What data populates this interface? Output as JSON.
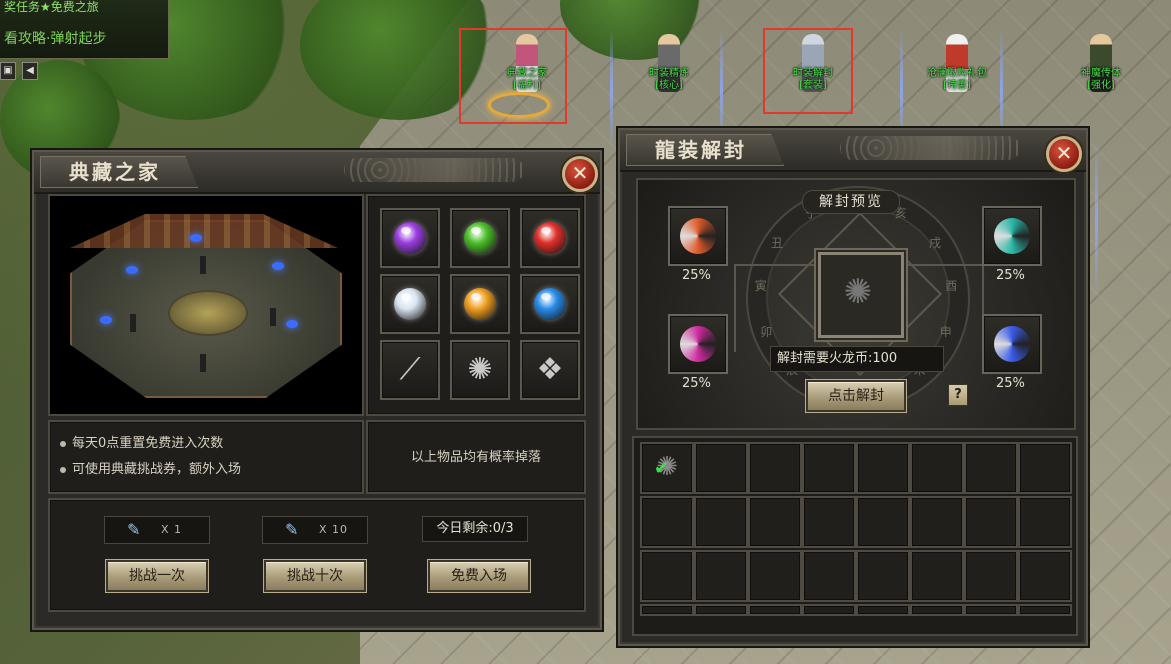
{
  "hud": {
    "line1": "奖任务★免费之旅",
    "line2": "看攻略·弹射起步",
    "arrow_label": "◀"
  },
  "npcs": [
    {
      "name": "典藏之家",
      "tag": "[福利]"
    },
    {
      "name": "时装精炼",
      "tag": "[核心]"
    },
    {
      "name": "时装解封",
      "tag": "[套装]"
    },
    {
      "name": "沧澜限购礼包",
      "tag": "[特惠]"
    },
    {
      "name": "神魔传体",
      "tag": "[强化]"
    }
  ],
  "left_panel": {
    "title": "典藏之家",
    "close_label": "✕",
    "items": [
      {
        "icon": "purple-gem-icon",
        "color": "#9b3fe0"
      },
      {
        "icon": "green-gem-icon",
        "color": "#4cc02a"
      },
      {
        "icon": "red-gem-icon",
        "color": "#e0302a"
      },
      {
        "icon": "white-gem-icon",
        "color": "#d8e4f0"
      },
      {
        "icon": "orange-gem-icon",
        "color": "#f0a020"
      },
      {
        "icon": "blue-gem-icon",
        "color": "#2a8ce8"
      },
      {
        "icon": "blade-icon",
        "glyph": "⟋"
      },
      {
        "icon": "dragon-claw-icon",
        "glyph": "✺"
      },
      {
        "icon": "wing-icon",
        "glyph": "❖"
      }
    ],
    "notes": [
      "每天0点重置免费进入次数",
      "可使用典藏挑战券，额外入场"
    ],
    "drop_note": "以上物品均有概率掉落",
    "ticket_1_qty": "X 1",
    "ticket_10_qty": "X 10",
    "remaining": "今日剩余:0/3",
    "challenge_once_label": "挑战一次",
    "challenge_ten_label": "挑战十次",
    "free_entry_label": "免费入场"
  },
  "right_panel": {
    "title": "龍装解封",
    "close_label": "✕",
    "preview_label": "解封预览",
    "slots": [
      {
        "pct": "25%",
        "icon": "fire-swirl-icon",
        "color": "#e05a2a"
      },
      {
        "pct": "25%",
        "icon": "teal-swirl-icon",
        "color": "#2ab8a8"
      },
      {
        "pct": "25%",
        "icon": "magenta-swirl-icon",
        "color": "#d02aa0"
      },
      {
        "pct": "25%",
        "icon": "blue-red-swirl-icon",
        "color": "#3a5ae8"
      }
    ],
    "cost_text": "解封需要火龙币:100",
    "unseal_button": "点击解封",
    "help_label": "?",
    "runes": [
      "文",
      "亥",
      "戌",
      "酉",
      "申",
      "未",
      "午",
      "巳",
      "辰",
      "卯",
      "寅",
      "丑",
      "子"
    ]
  }
}
